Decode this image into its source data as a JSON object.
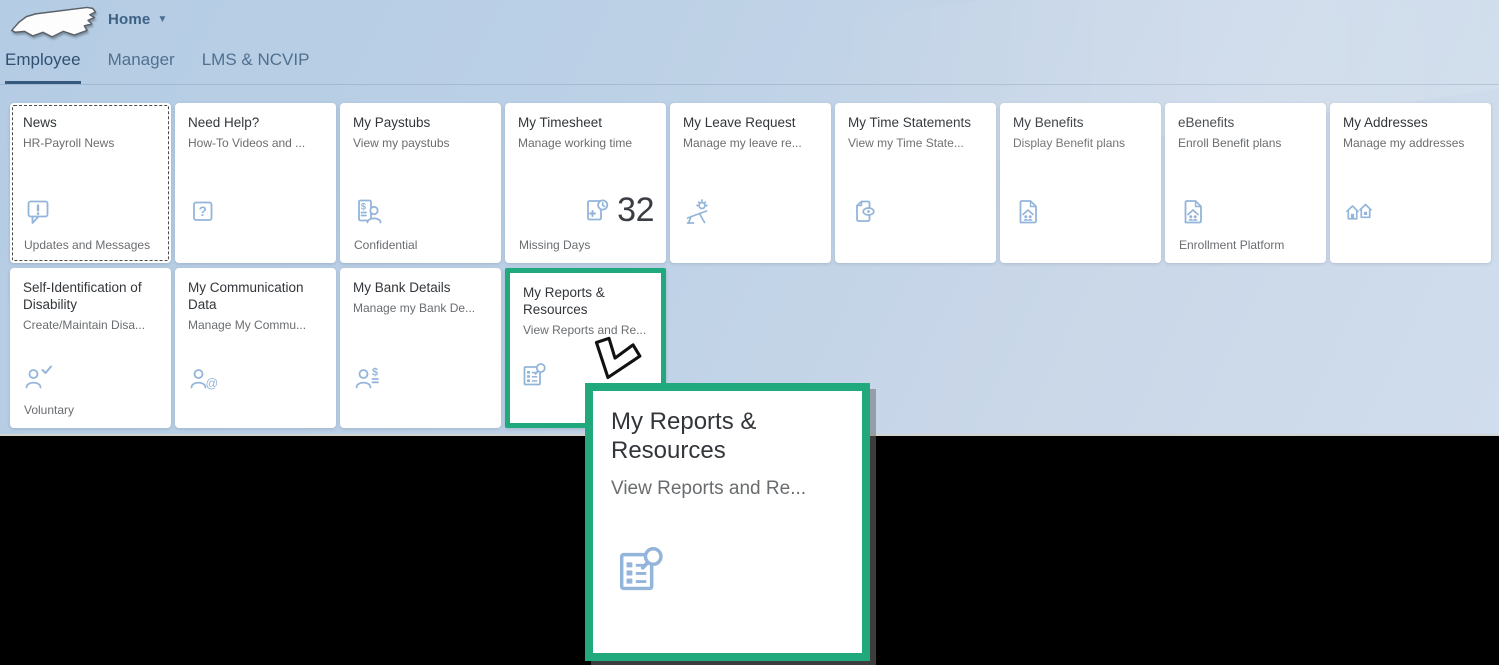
{
  "header": {
    "logo_name": "north-carolina-outline",
    "menu_label": "Home",
    "menu_caret": "▼",
    "tabs": [
      {
        "label": "Employee",
        "selected": true
      },
      {
        "label": "Manager",
        "selected": false
      },
      {
        "label": "LMS & NCVIP",
        "selected": false
      }
    ]
  },
  "tile_rows": [
    [
      {
        "title": "News",
        "subtitle": "HR-Payroll News",
        "icon": "feedback-icon",
        "footer": "Updates and Messages",
        "focus_dotted": true
      },
      {
        "title": "Need Help?",
        "subtitle": "How-To Videos and ...",
        "icon": "question-mark-icon"
      },
      {
        "title": "My Paystubs",
        "subtitle": "View my paystubs",
        "icon": "paystub-person-icon",
        "footer": "Confidential"
      },
      {
        "title": "My Timesheet",
        "subtitle": "Manage working time",
        "icon": "timesheet-clock-icon",
        "number": "32",
        "footer": "Missing Days"
      },
      {
        "title": "My Leave Request",
        "subtitle": "Manage my leave re...",
        "icon": "vacation-icon"
      },
      {
        "title": "My Time Statements",
        "subtitle": "View my Time State...",
        "icon": "document-view-icon"
      },
      {
        "title": "My Benefits",
        "subtitle": "Display Benefit plans",
        "icon": "benefits-family-icon"
      },
      {
        "title": "eBenefits",
        "subtitle": "Enroll Benefit plans",
        "icon": "benefits-family-icon",
        "footer": "Enrollment Platform"
      },
      {
        "title": "My Addresses",
        "subtitle": "Manage my addresses",
        "icon": "houses-icon"
      }
    ],
    [
      {
        "title": "Self-Identification of Disability",
        "subtitle": "Create/Maintain Disa...",
        "icon": "person-check-icon",
        "footer": "Voluntary"
      },
      {
        "title": "My Communication Data",
        "subtitle": "Manage My Commu...",
        "icon": "person-at-icon"
      },
      {
        "title": "My Bank Details",
        "subtitle": "Manage my Bank De...",
        "icon": "person-dollar-icon"
      },
      {
        "title": "My Reports & Resources",
        "subtitle": "View Reports and Re...",
        "icon": "report-search-icon",
        "highlighted": true
      }
    ]
  ],
  "popup": {
    "title": "My Reports & Resources",
    "subtitle": "View Reports and Re...",
    "icon": "report-search-icon"
  },
  "cursor": "arrow-cursor-pointing-down-left",
  "colors": {
    "accent_teal": "#1fa97c",
    "icon_blue": "#94b5da",
    "tile_title": "#32363a",
    "tile_subtitle": "#6a6d70",
    "kpi_number": "#3a3e44",
    "tab_text": "#50708f",
    "tab_selected": "#2f5070",
    "header_text": "#3d6185",
    "background_top": "#b4cce4",
    "background_bottom": "#d0ddec",
    "letterbox": "#000000"
  }
}
